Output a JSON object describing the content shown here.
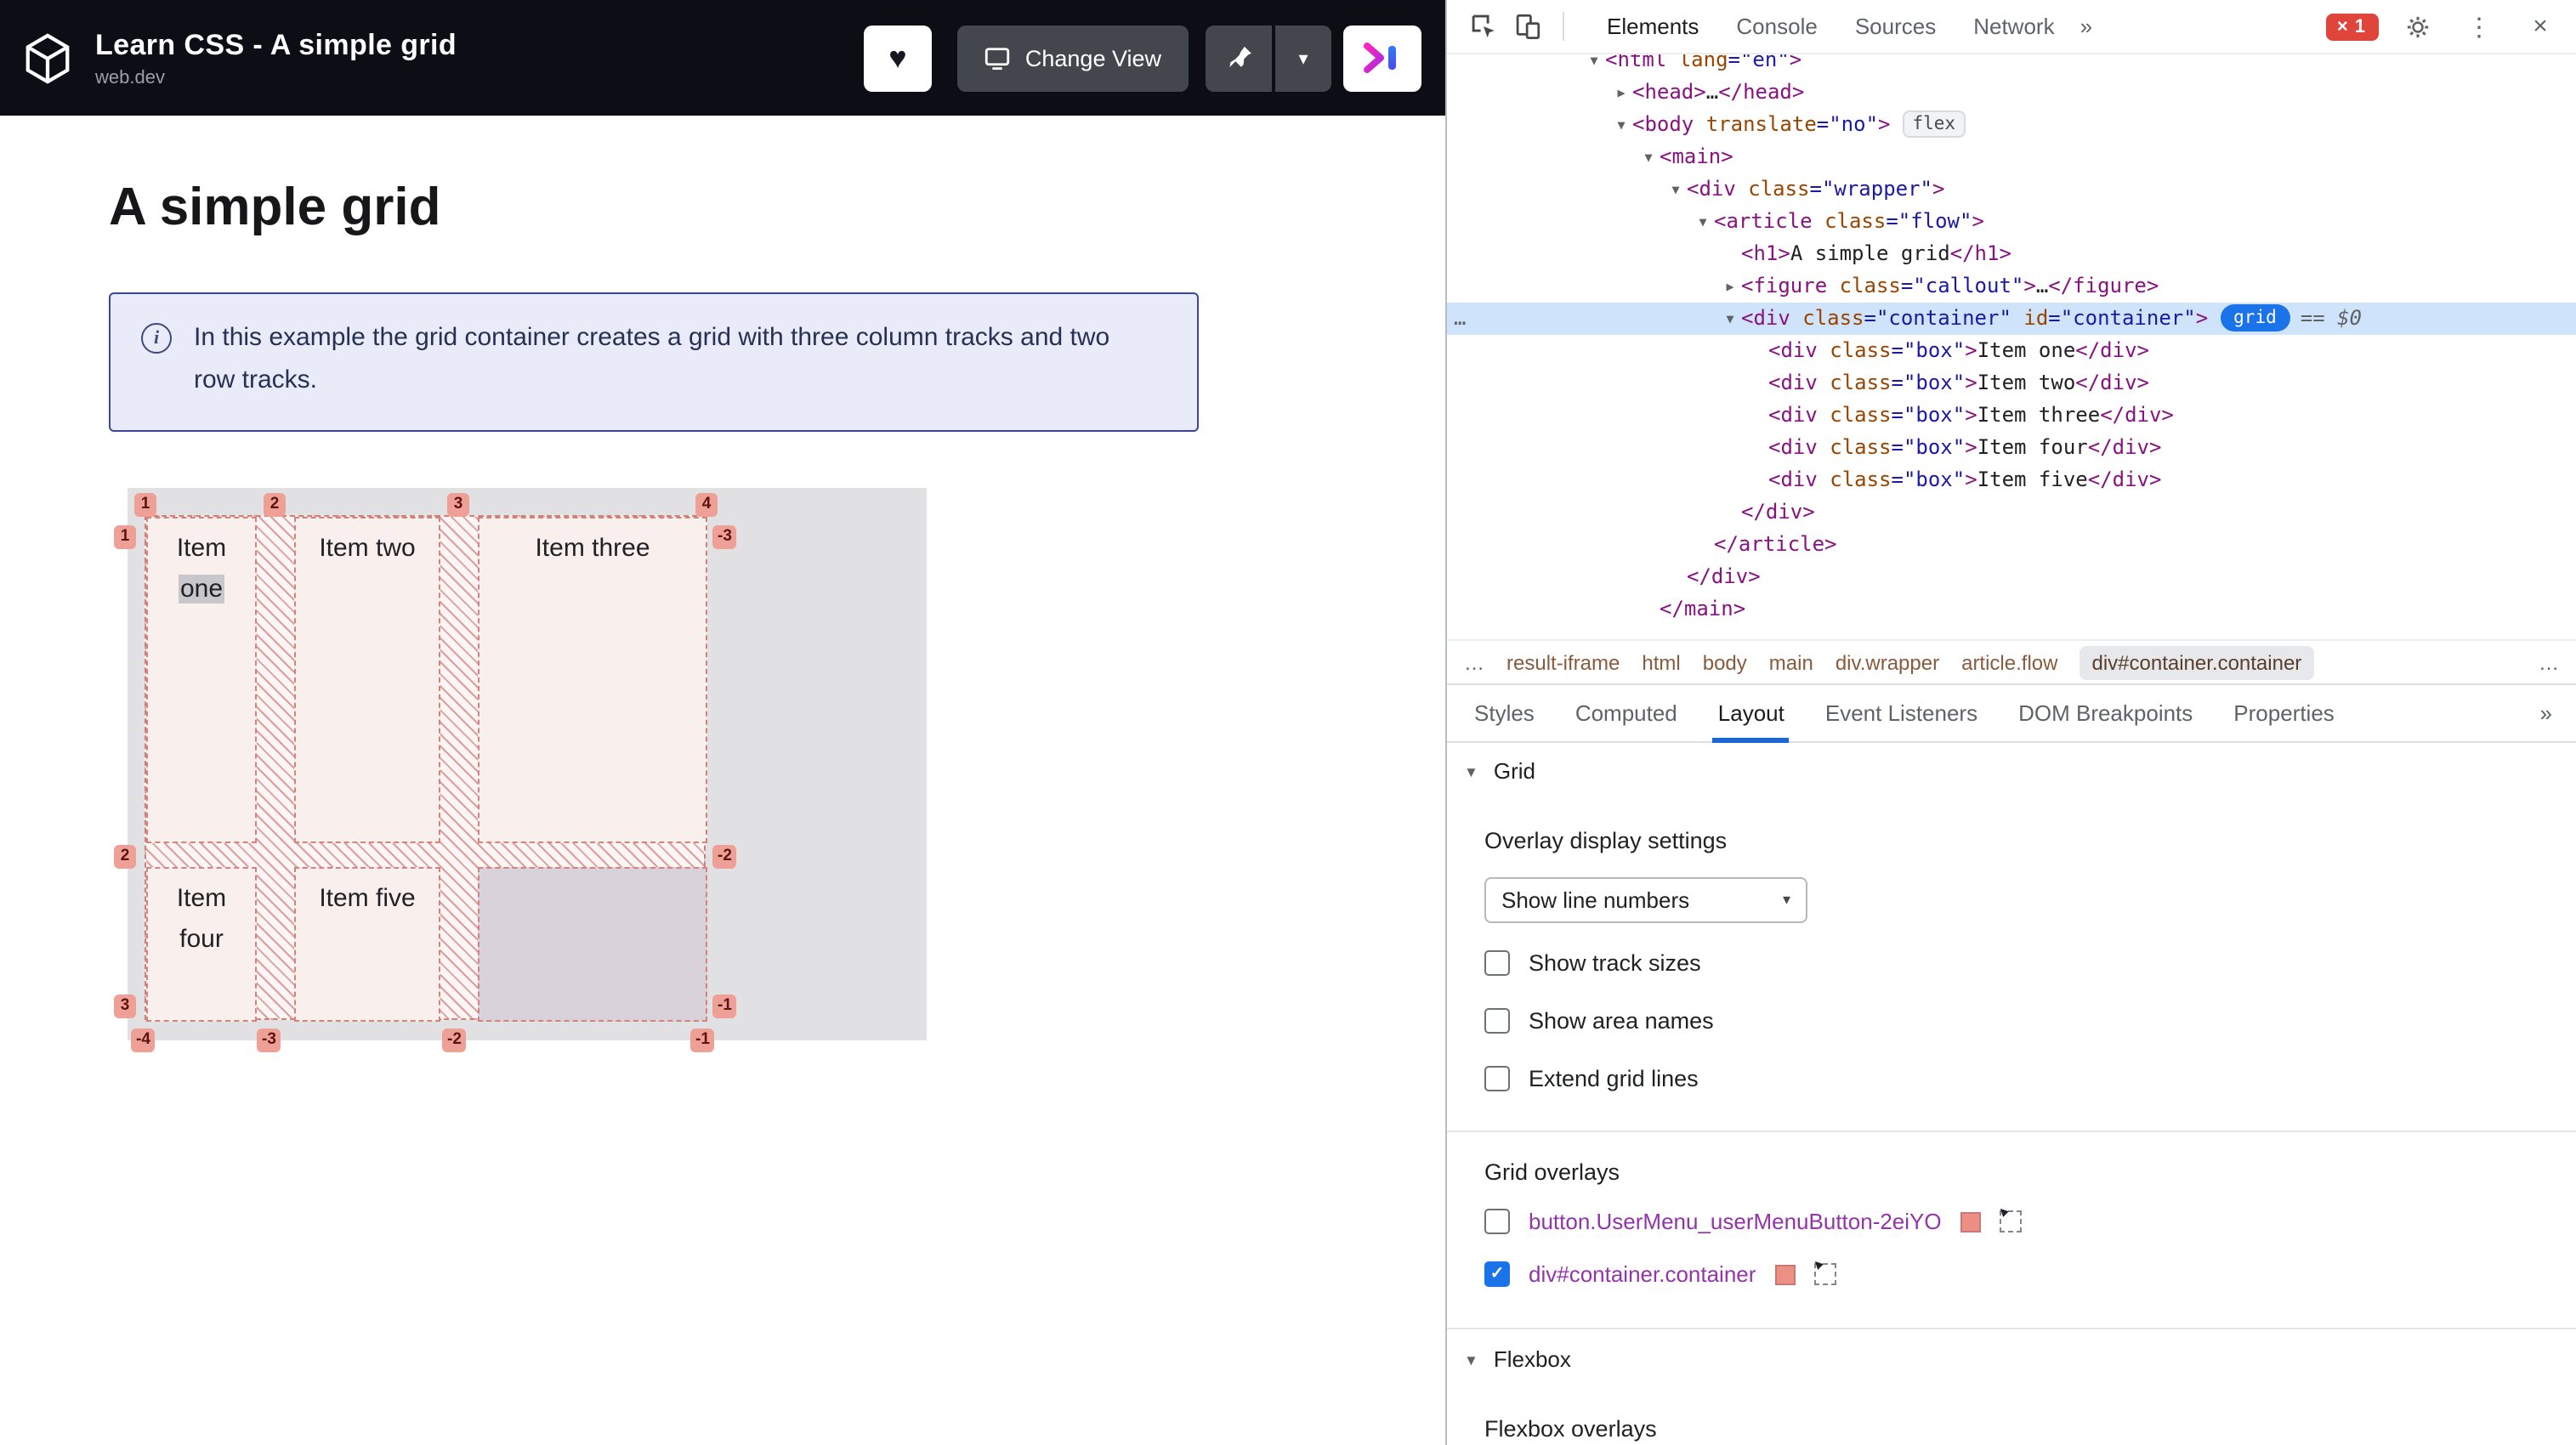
{
  "icons": {
    "heart": "♥",
    "chevron_down": "▾",
    "dots": "⋮",
    "close": "×",
    "error_x": "×",
    "ellipsis": "…",
    "chevrons": "»",
    "triangle_down": "▼",
    "triangle_right": "▶",
    "check": "✓",
    "info": "i"
  },
  "colors": {
    "accent_blue": "#1a73e8",
    "grid_overlay_pink": "#ee8f86",
    "error_red": "#e0453c",
    "header_bg": "#0d0d16",
    "devtools_tag_purple": "#881280",
    "devtools_attr_brown": "#994500",
    "devtools_value_blue": "#1a1aa6"
  },
  "header": {
    "title": "Learn CSS - A simple grid",
    "subtitle": "web.dev",
    "change_view_label": "Change View"
  },
  "page": {
    "heading": "A simple grid",
    "callout_text": "In this example the grid container creates a grid with three column tracks and two row tracks.",
    "grid": {
      "top_lines": [
        "1",
        "2",
        "3",
        "4"
      ],
      "bottom_lines": [
        "-4",
        "-3",
        "-2",
        "-1"
      ],
      "left_lines": [
        "1",
        "2",
        "3"
      ],
      "right_lines": [
        "-3",
        "-2",
        "-1"
      ],
      "items": [
        {
          "word1": "Item",
          "word2": "one"
        },
        {
          "label": "Item two"
        },
        {
          "label": "Item three"
        },
        {
          "word1": "Item",
          "word2": "four"
        },
        {
          "label": "Item five"
        }
      ]
    }
  },
  "devtools": {
    "main_tabs": [
      {
        "label": "Elements",
        "selected": true
      },
      {
        "label": "Console"
      },
      {
        "label": "Sources"
      },
      {
        "label": "Network"
      }
    ],
    "toolbar": {
      "error_count": "1"
    },
    "dom_lines": [
      {
        "i": 0,
        "a": "v",
        "s": [
          [
            "<html ",
            "p"
          ],
          [
            "lang",
            "a"
          ],
          [
            "=\"en\"",
            "v"
          ],
          [
            ">",
            "p"
          ]
        ]
      },
      {
        "i": 1,
        "a": "r",
        "s": [
          [
            "<head>",
            "p"
          ],
          [
            "…",
            "t"
          ],
          [
            "</head>",
            "p"
          ]
        ]
      },
      {
        "i": 1,
        "a": "v",
        "badge": "flex",
        "s": [
          [
            "<body ",
            "p"
          ],
          [
            "translate",
            "a"
          ],
          [
            "=\"no\"",
            "v"
          ],
          [
            ">",
            "p"
          ]
        ]
      },
      {
        "i": 2,
        "a": "v",
        "s": [
          [
            "<main>",
            "p"
          ]
        ]
      },
      {
        "i": 3,
        "a": "v",
        "s": [
          [
            "<div ",
            "p"
          ],
          [
            "class",
            "a"
          ],
          [
            "=\"wrapper\"",
            "v"
          ],
          [
            ">",
            "p"
          ]
        ]
      },
      {
        "i": 4,
        "a": "v",
        "s": [
          [
            "<article ",
            "p"
          ],
          [
            "class",
            "a"
          ],
          [
            "=\"flow\"",
            "v"
          ],
          [
            ">",
            "p"
          ]
        ]
      },
      {
        "i": 5,
        "a": "",
        "s": [
          [
            "<h1>",
            "p"
          ],
          [
            "A simple grid",
            "t"
          ],
          [
            "</h1>",
            "p"
          ]
        ]
      },
      {
        "i": 5,
        "a": "r",
        "s": [
          [
            "<figure ",
            "p"
          ],
          [
            "class",
            "a"
          ],
          [
            "=\"callout\"",
            "v"
          ],
          [
            ">",
            "p"
          ],
          [
            "…",
            "t"
          ],
          [
            "</figure>",
            "p"
          ]
        ]
      },
      {
        "i": 5,
        "a": "v",
        "sel": true,
        "badge": "grid",
        "tail": "== $0",
        "s": [
          [
            "<div ",
            "p"
          ],
          [
            "class",
            "a"
          ],
          [
            "=\"container\"",
            "v"
          ],
          [
            " ",
            "t"
          ],
          [
            "id",
            "a"
          ],
          [
            "=\"container\"",
            "v"
          ],
          [
            ">",
            "p"
          ]
        ]
      },
      {
        "i": 6,
        "a": "",
        "s": [
          [
            "<div ",
            "p"
          ],
          [
            "class",
            "a"
          ],
          [
            "=\"box\"",
            "v"
          ],
          [
            ">",
            "p"
          ],
          [
            "Item one",
            "t"
          ],
          [
            "</div>",
            "p"
          ]
        ]
      },
      {
        "i": 6,
        "a": "",
        "s": [
          [
            "<div ",
            "p"
          ],
          [
            "class",
            "a"
          ],
          [
            "=\"box\"",
            "v"
          ],
          [
            ">",
            "p"
          ],
          [
            "Item two",
            "t"
          ],
          [
            "</div>",
            "p"
          ]
        ]
      },
      {
        "i": 6,
        "a": "",
        "s": [
          [
            "<div ",
            "p"
          ],
          [
            "class",
            "a"
          ],
          [
            "=\"box\"",
            "v"
          ],
          [
            ">",
            "p"
          ],
          [
            "Item three",
            "t"
          ],
          [
            "</div>",
            "p"
          ]
        ]
      },
      {
        "i": 6,
        "a": "",
        "s": [
          [
            "<div ",
            "p"
          ],
          [
            "class",
            "a"
          ],
          [
            "=\"box\"",
            "v"
          ],
          [
            ">",
            "p"
          ],
          [
            "Item four",
            "t"
          ],
          [
            "</div>",
            "p"
          ]
        ]
      },
      {
        "i": 6,
        "a": "",
        "s": [
          [
            "<div ",
            "p"
          ],
          [
            "class",
            "a"
          ],
          [
            "=\"box\"",
            "v"
          ],
          [
            ">",
            "p"
          ],
          [
            "Item five",
            "t"
          ],
          [
            "</div>",
            "p"
          ]
        ]
      },
      {
        "i": 5,
        "a": "",
        "s": [
          [
            "</div>",
            "p"
          ]
        ]
      },
      {
        "i": 4,
        "a": "",
        "s": [
          [
            "</article>",
            "p"
          ]
        ]
      },
      {
        "i": 3,
        "a": "",
        "s": [
          [
            "</div>",
            "p"
          ]
        ]
      },
      {
        "i": 2,
        "a": "",
        "s": [
          [
            "</main>",
            "p"
          ]
        ]
      }
    ],
    "breadcrumbs": [
      {
        "label": "…",
        "muted": true
      },
      {
        "label": "result-iframe"
      },
      {
        "label": "html"
      },
      {
        "label": "body"
      },
      {
        "label": "main"
      },
      {
        "label": "div.wrapper"
      },
      {
        "label": "article.flow"
      },
      {
        "label": "div#container.container",
        "selected": true
      },
      {
        "label": "…",
        "muted": true,
        "trailing": true
      }
    ],
    "sidebar_tabs": [
      {
        "label": "Styles"
      },
      {
        "label": "Computed"
      },
      {
        "label": "Layout",
        "selected": true
      },
      {
        "label": "Event Listeners"
      },
      {
        "label": "DOM Breakpoints"
      },
      {
        "label": "Properties"
      }
    ],
    "layout_panel": {
      "grid_section": "Grid",
      "overlay_settings_label": "Overlay display settings",
      "line_numbers_value": "Show line numbers",
      "display_settings": [
        {
          "label": "Show track sizes",
          "checked": false
        },
        {
          "label": "Show area names",
          "checked": false
        },
        {
          "label": "Extend grid lines",
          "checked": false
        }
      ],
      "grid_overlays_label": "Grid overlays",
      "overlays": [
        {
          "label": "button.UserMenu_userMenuButton-2eiYO",
          "checked": false
        },
        {
          "label": "div#container.container",
          "checked": true
        }
      ],
      "flexbox_section": "Flexbox",
      "flexbox_overlays_label": "Flexbox overlays"
    }
  }
}
